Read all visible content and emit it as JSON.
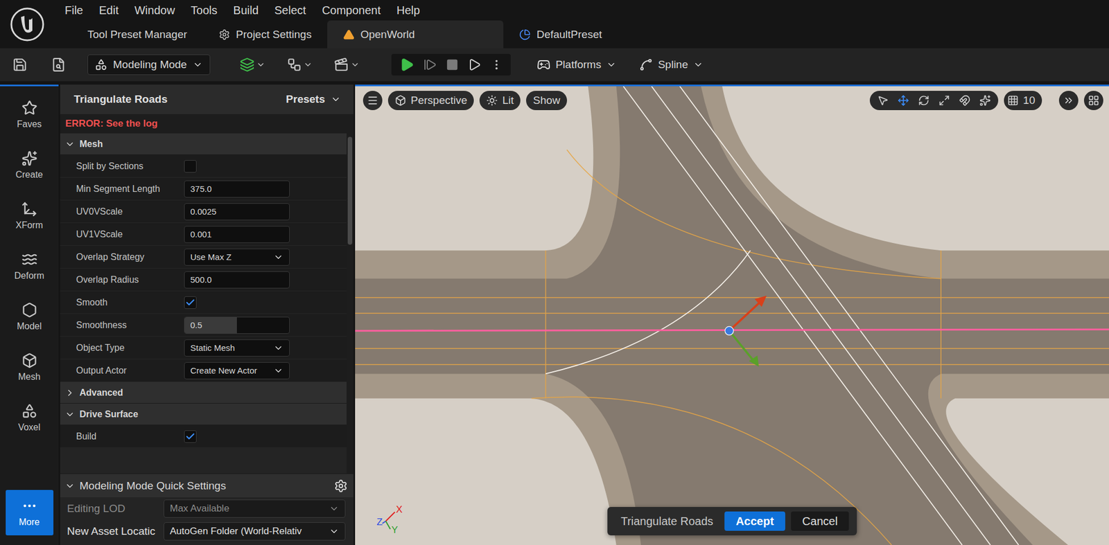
{
  "menu": [
    "File",
    "Edit",
    "Window",
    "Tools",
    "Build",
    "Select",
    "Component",
    "Help"
  ],
  "tabs": [
    {
      "label": "Tool Preset Manager",
      "selected": false
    },
    {
      "label": "Project Settings",
      "selected": false
    },
    {
      "label": "OpenWorld",
      "selected": true
    },
    {
      "label": "DefaultPreset",
      "selected": false
    }
  ],
  "toolbar": {
    "mode": "Modeling Mode",
    "platforms": "Platforms",
    "spline": "Spline"
  },
  "sidebar": {
    "items": [
      {
        "label": "Faves",
        "selected": false
      },
      {
        "label": "Create",
        "selected": false
      },
      {
        "label": "XForm",
        "selected": false
      },
      {
        "label": "Deform",
        "selected": false
      },
      {
        "label": "Model",
        "selected": false
      },
      {
        "label": "Mesh",
        "selected": false
      },
      {
        "label": "Voxel",
        "selected": false
      },
      {
        "label": "More",
        "selected": true
      }
    ]
  },
  "tool_panel": {
    "title": "Triangulate Roads",
    "presets": "Presets",
    "error": "ERROR: See the log",
    "sections": [
      {
        "title": "Mesh",
        "expanded": true,
        "rows": [
          {
            "label": "Split by Sections",
            "kind": "checkbox",
            "checked": false
          },
          {
            "label": "Min Segment Length",
            "kind": "number",
            "value": "375.0"
          },
          {
            "label": "UV0VScale",
            "kind": "number",
            "value": "0.0025"
          },
          {
            "label": "UV1VScale",
            "kind": "number",
            "value": "0.001"
          },
          {
            "label": "Overlap Strategy",
            "kind": "dropdown",
            "value": "Use Max Z"
          },
          {
            "label": "Overlap Radius",
            "kind": "number",
            "value": "500.0"
          },
          {
            "label": "Smooth",
            "kind": "checkbox",
            "checked": true
          },
          {
            "label": "Smoothness",
            "kind": "slider",
            "value": "0.5",
            "level": 0.5
          },
          {
            "label": "Object Type",
            "kind": "dropdown",
            "value": "Static Mesh"
          },
          {
            "label": "Output Actor",
            "kind": "dropdown",
            "value": "Create New Actor"
          }
        ]
      },
      {
        "title": "Advanced",
        "expanded": false,
        "rows": []
      },
      {
        "title": "Drive Surface",
        "expanded": true,
        "rows": [
          {
            "label": "Build",
            "kind": "checkbox",
            "checked": true
          }
        ]
      }
    ]
  },
  "quick_settings": {
    "title": "Modeling Mode Quick Settings",
    "expanded": true,
    "rows": [
      {
        "label": "Editing LOD",
        "value": "Max Available",
        "disabled": true
      },
      {
        "label": "New Asset Locatic",
        "value": "AutoGen Folder (World-Relativ",
        "disabled": false
      }
    ]
  },
  "viewport": {
    "view": "Perspective",
    "lighting": "Lit",
    "show": "Show",
    "grid_size": "10",
    "tools": [
      {
        "kind": "select",
        "selected": false
      },
      {
        "kind": "move",
        "selected": true
      },
      {
        "kind": "rotate",
        "selected": false
      },
      {
        "kind": "scale",
        "selected": false
      }
    ],
    "axes": [
      "X",
      "Z",
      "Y"
    ]
  },
  "confirm_bar": {
    "label": "Triangulate Roads",
    "buttons": [
      {
        "label": "Accept",
        "primary": true
      },
      {
        "label": "Cancel",
        "primary": false
      }
    ]
  }
}
